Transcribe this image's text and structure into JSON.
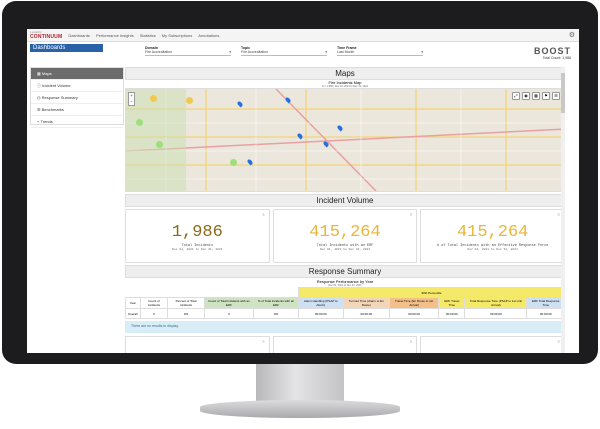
{
  "topbar": {
    "logo": "CONTINUUM",
    "logo_sub": "Locality",
    "nav": [
      "Dashboards",
      "Performance Insights",
      "Statistics",
      "My Subscriptions",
      "Annotations"
    ]
  },
  "dashboards_title": "Dashboards",
  "filters": {
    "domain": {
      "label": "Domain",
      "value": "Fire Accreditation"
    },
    "topic": {
      "label": "Topic",
      "value": "Fire Accreditation"
    },
    "timeframe": {
      "label": "Time Frame",
      "value": "Last Month"
    }
  },
  "brand": {
    "name": "BOOST",
    "total": "Total Count: 1,986"
  },
  "sidebar": {
    "items": [
      {
        "label": "Maps",
        "active": true
      },
      {
        "label": "Incident Volume"
      },
      {
        "label": "Response Summary"
      },
      {
        "label": "Benchmarks"
      },
      {
        "label": "Trends"
      }
    ]
  },
  "maps": {
    "header": "Maps",
    "title": "Fire Incidents Map",
    "subtitle": "N = 1,986 | Dec 01, 2021 to Dec 31, 2021"
  },
  "incident_volume": {
    "header": "Incident Volume",
    "kpis": [
      {
        "value": "1,986",
        "label": "Total Incidents",
        "dates": "Dec 01, 2021 to Dec 31, 2021",
        "color": "#8a6a1a"
      },
      {
        "value": "415,264",
        "label": "Total Incidents with an ERF",
        "dates": "Dec 01, 2021 to Dec 31, 2021",
        "color": "#e8b63a"
      },
      {
        "value": "415,264",
        "label": "# of Total Incidents with an Effective Response Force",
        "dates": "Dec 01, 2021 to Dec 31, 2021",
        "color": "#e8b63a"
      }
    ]
  },
  "response_summary": {
    "header": "Response Summary",
    "title": "Response Performance by Year",
    "subtitle": "Dec 01, 2021 to Dec 31, 2021",
    "percentile_label": "90th Percentile",
    "columns": [
      "Year",
      "Count of Incidents",
      "Percent of Total Incidents",
      "Count of Total Incidents with an ERF",
      "% of Total Incidents with an ERF",
      "Alarm Handling (PSAP to Alarm)",
      "Turnout Time (Alarm to En Route)",
      "Travel Time (En Route to 1st Arrival)",
      "ERF Travel Time",
      "Total Response Time (PSAP to 1st Unit Arrival)",
      "ERF Total Response Time"
    ],
    "rows": [
      [
        "Overall",
        "0",
        "0%",
        "0",
        "0%",
        "00:00:00",
        "00:00:00",
        "00:00:00",
        "00:00:00",
        "00:00:00",
        "00:00:00"
      ]
    ],
    "no_results": "There are no results to display."
  }
}
